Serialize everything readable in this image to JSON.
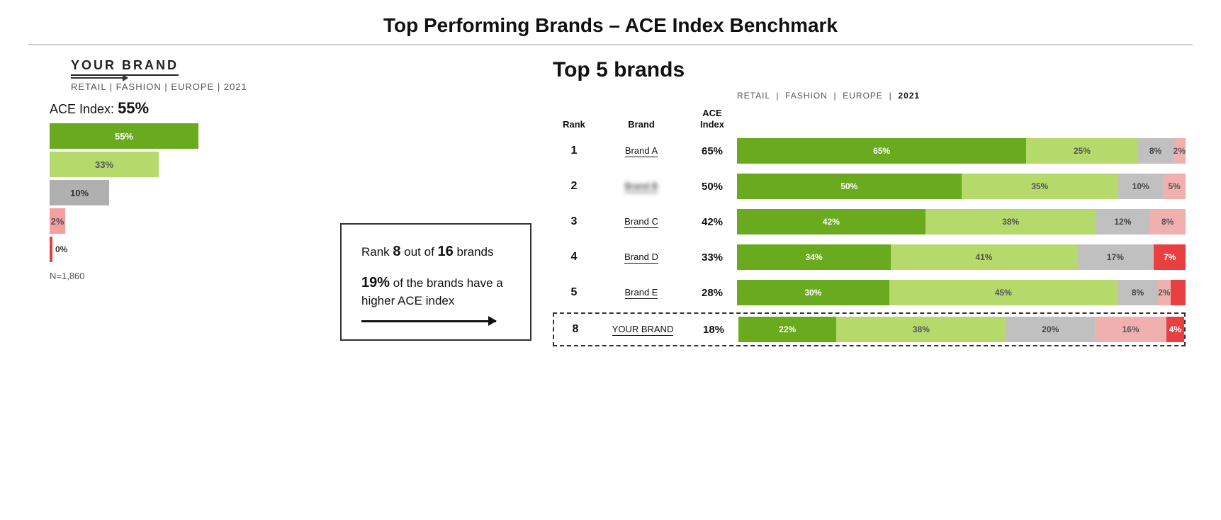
{
  "title": "Top Performing Brands – ACE Index Benchmark",
  "left": {
    "brand_name": "YOUR BRAND",
    "subtitle": "RETAIL  |  FASHION  |  EUROPE  | 2021",
    "ace_index_label": "ACE Index:",
    "ace_index_value": "55%",
    "bars": [
      {
        "label": "55%",
        "color": "dark-green",
        "width_pct": 75
      },
      {
        "label": "33%",
        "color": "light-green",
        "width_pct": 55
      },
      {
        "label": "10%",
        "color": "grey",
        "width_pct": 30
      },
      {
        "label": "2%",
        "color": "pink",
        "width_pct": 8,
        "is_thin": false
      },
      {
        "label": "0%",
        "color": "red-thin",
        "width_pct": 2
      }
    ],
    "n_label": "N=1,860"
  },
  "middle": {
    "rank_text_1": "Rank ",
    "rank_bold_1": "8",
    "rank_text_2": " out of ",
    "rank_bold_2": "16",
    "rank_text_3": " brands",
    "pct_text_1": "",
    "pct_bold": "19%",
    "pct_text_2": " of the brands have a higher ACE index"
  },
  "right": {
    "top5_title": "Top 5 brands",
    "subtitle": "RETAIL  |  FASHION  |  EUROPE  |  2021",
    "col_rank": "Rank",
    "col_brand": "Brand",
    "col_ace": "ACE Index",
    "rows": [
      {
        "rank": "1",
        "brand": "Brand A",
        "blurred": false,
        "ace": "65%",
        "segs": [
          {
            "label": "65%",
            "color": "dark-green",
            "flex": 65
          },
          {
            "label": "25%",
            "color": "light-green",
            "flex": 25
          },
          {
            "label": "8%",
            "color": "grey",
            "flex": 8
          },
          {
            "label": "2%",
            "color": "pink",
            "flex": 2
          }
        ]
      },
      {
        "rank": "2",
        "brand": "Brand B",
        "blurred": true,
        "ace": "50%",
        "segs": [
          {
            "label": "50%",
            "color": "dark-green",
            "flex": 50
          },
          {
            "label": "35%",
            "color": "light-green",
            "flex": 35
          },
          {
            "label": "10%",
            "color": "grey",
            "flex": 10
          },
          {
            "label": "5%",
            "color": "pink",
            "flex": 5
          }
        ]
      },
      {
        "rank": "3",
        "brand": "Brand C",
        "blurred": false,
        "ace": "42%",
        "segs": [
          {
            "label": "42%",
            "color": "dark-green",
            "flex": 42
          },
          {
            "label": "38%",
            "color": "light-green",
            "flex": 38
          },
          {
            "label": "12%",
            "color": "grey",
            "flex": 12
          },
          {
            "label": "8%",
            "color": "pink",
            "flex": 8
          }
        ]
      },
      {
        "rank": "4",
        "brand": "Brand D",
        "blurred": false,
        "ace": "33%",
        "segs": [
          {
            "label": "34%",
            "color": "dark-green",
            "flex": 34
          },
          {
            "label": "41%",
            "color": "light-green",
            "flex": 41
          },
          {
            "label": "17%",
            "color": "grey",
            "flex": 17
          },
          {
            "label": "7%",
            "color": "red",
            "flex": 7
          }
        ]
      },
      {
        "rank": "5",
        "brand": "Brand E",
        "blurred": false,
        "ace": "28%",
        "segs": [
          {
            "label": "30%",
            "color": "dark-green",
            "flex": 30
          },
          {
            "label": "45%",
            "color": "light-green",
            "flex": 45
          },
          {
            "label": "8%",
            "color": "grey",
            "flex": 8
          },
          {
            "label": "2%",
            "color": "pink",
            "flex": 2
          },
          {
            "label": "",
            "color": "red",
            "flex": 3
          }
        ]
      },
      {
        "rank": "8",
        "brand": "YOUR BRAND",
        "blurred": false,
        "is_your_brand": true,
        "ace": "18%",
        "segs": [
          {
            "label": "22%",
            "color": "dark-green",
            "flex": 22
          },
          {
            "label": "38%",
            "color": "light-green",
            "flex": 38
          },
          {
            "label": "20%",
            "color": "grey",
            "flex": 20
          },
          {
            "label": "16%",
            "color": "pink",
            "flex": 16
          },
          {
            "label": "4%",
            "color": "red",
            "flex": 4
          }
        ]
      }
    ]
  }
}
